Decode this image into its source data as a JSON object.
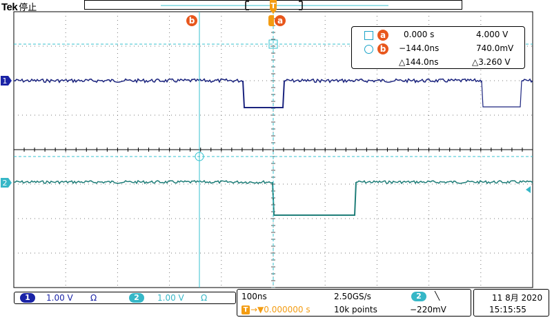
{
  "header": {
    "brand": "Tek",
    "run_state": "停止"
  },
  "cursor_readout": {
    "a": {
      "label": "a",
      "time": "0.000 s",
      "value": "4.000 V"
    },
    "b": {
      "label": "b",
      "time": "−144.0ns",
      "value": "740.0mV"
    },
    "delta_time": "△144.0ns",
    "delta_value": "△3.260 V"
  },
  "markers": {
    "cursor_a": "a",
    "cursor_b": "b",
    "trigger": "T"
  },
  "channels": [
    {
      "id": "1",
      "scale": "1.00 V",
      "coupling": "Ω",
      "color": "#1a23a6"
    },
    {
      "id": "2",
      "scale": "1.00 V",
      "coupling": "Ω",
      "color": "#36b7c7"
    }
  ],
  "acquisition": {
    "timebase": "100ns",
    "sample_rate": "2.50GS/s",
    "trigger_source": "2",
    "trigger_slope": "╲",
    "trigger_position": "→▼0.000000 s",
    "record_length": "10k points",
    "trigger_level": "−220mV"
  },
  "clock": {
    "date": "11 8月 2020",
    "time": "15:15:55"
  },
  "colors": {
    "ch1": "#1a237e",
    "ch2": "#1e7d78",
    "cursor": "#35c2cf",
    "trigger": "#f39c12",
    "marker": "#e8571c"
  }
}
